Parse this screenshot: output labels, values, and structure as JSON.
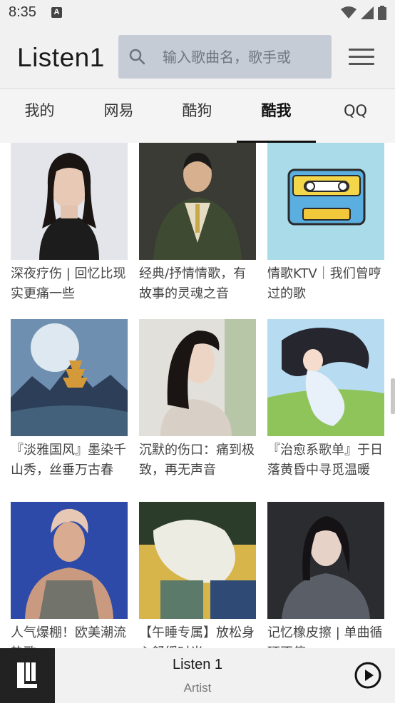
{
  "status_bar": {
    "time": "8:35",
    "notification_icon": "a-notification-icon",
    "icons": [
      "wifi-icon",
      "signal-icon",
      "battery-icon"
    ]
  },
  "header": {
    "app_title": "Listen1",
    "search_placeholder": "输入歌曲名，歌手或",
    "search_value": ""
  },
  "tabs": [
    {
      "label": "我的",
      "active": false
    },
    {
      "label": "网易",
      "active": false
    },
    {
      "label": "酷狗",
      "active": false
    },
    {
      "label": "酷我",
      "active": true
    },
    {
      "label": "QQ",
      "active": false
    }
  ],
  "playlists": [
    {
      "title": "深夜疗伤 | 回忆比现实更痛一些",
      "cover": "portrait-woman-black-dress"
    },
    {
      "title": "经典/抒情情歌，有故事的灵魂之音",
      "cover": "man-in-suit"
    },
    {
      "title": "情歌KTV｜我们曾哼过的歌",
      "cover": "cassette-tape"
    },
    {
      "title": "『淡雅国风』墨染千山秀，丝垂万古春",
      "cover": "moon-pagoda-landscape"
    },
    {
      "title": "沉默的伤口：痛到极致，再无声音",
      "cover": "woman-profile"
    },
    {
      "title": "『治愈系歌单』于日落黄昏中寻觅温暖",
      "cover": "anime-girl-meadow"
    },
    {
      "title": "人气爆棚！欧美潮流热歌",
      "cover": "shirtless-singer"
    },
    {
      "title": "【午睡专属】放松身心舒缓时光",
      "cover": "illustration-sleeping"
    },
    {
      "title": "记忆橡皮擦 | 单曲循环不停",
      "cover": "woman-dark-portrait"
    }
  ],
  "player": {
    "track": "Listen 1",
    "artist": "Artist"
  },
  "colors": {
    "header_bg": "#f1f1f1",
    "search_bg": "#c6ccd6",
    "active_tab_indicator": "#111111",
    "player_logo_bg": "#222222"
  }
}
